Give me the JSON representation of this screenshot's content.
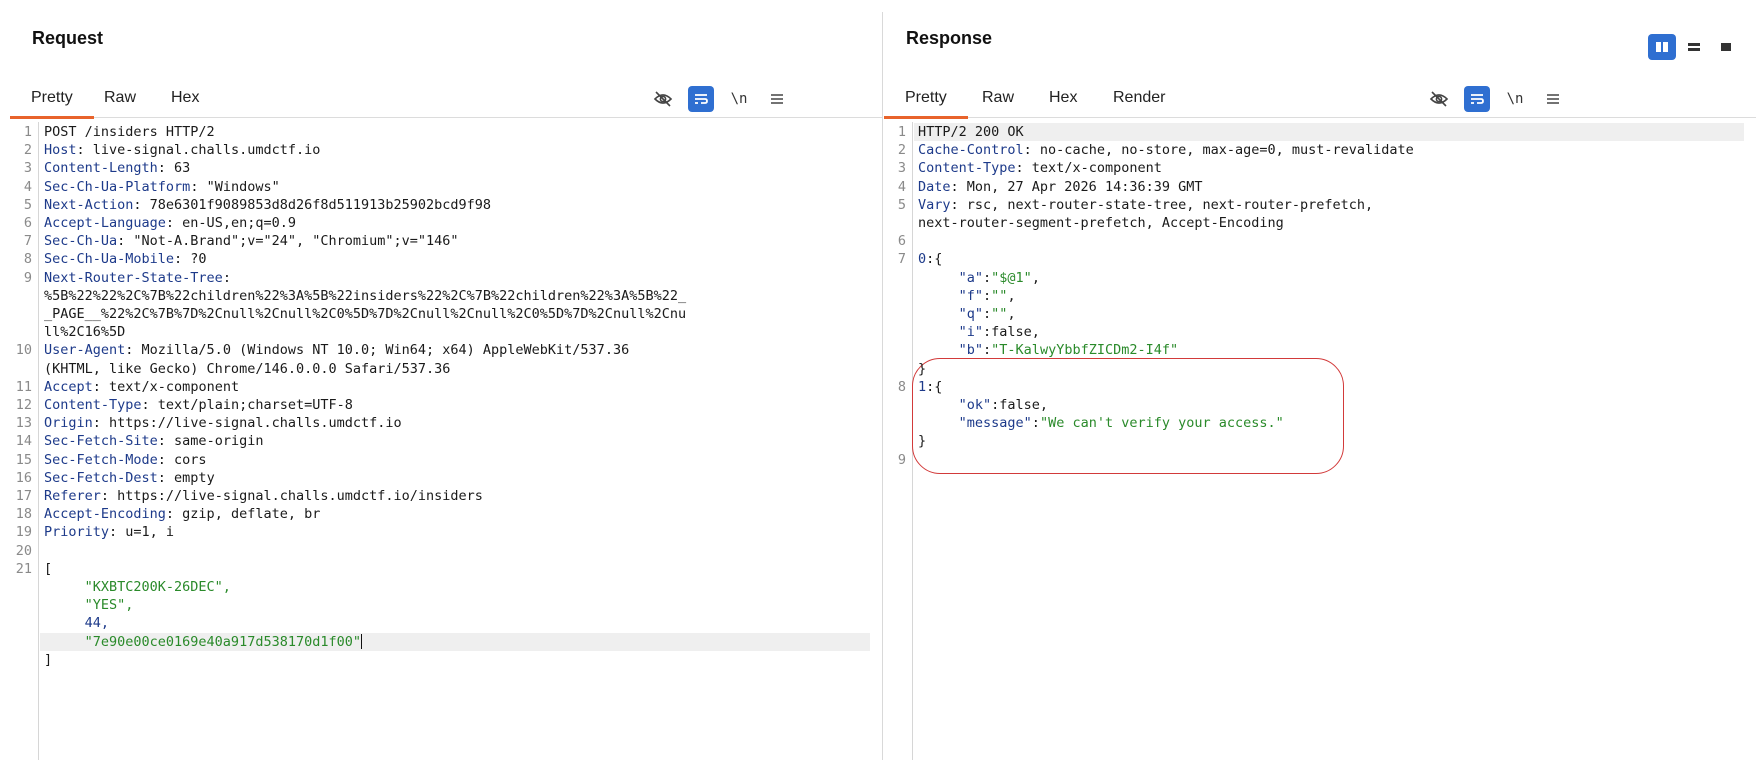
{
  "layout_switch": {
    "options": [
      "split-vertical-icon",
      "split-horizontal-icon",
      "single-pane-icon"
    ],
    "active": 0
  },
  "request": {
    "title": "Request",
    "tabs": [
      "Pretty",
      "Raw",
      "Hex"
    ],
    "active_tab": "Pretty",
    "toolbar": {
      "newline_label": "\\n"
    },
    "lines": [
      {
        "n": "1",
        "parts": [
          {
            "t": "POST /insiders HTTP/2",
            "c": "val"
          }
        ]
      },
      {
        "n": "2",
        "parts": [
          {
            "t": "Host",
            "c": "hdr"
          },
          {
            "t": ": live-signal.challs.umdctf.io",
            "c": "val"
          }
        ]
      },
      {
        "n": "3",
        "parts": [
          {
            "t": "Content-Length",
            "c": "hdr"
          },
          {
            "t": ": 63",
            "c": "val"
          }
        ]
      },
      {
        "n": "4",
        "parts": [
          {
            "t": "Sec-Ch-Ua-Platform",
            "c": "hdr"
          },
          {
            "t": ": \"Windows\"",
            "c": "val"
          }
        ]
      },
      {
        "n": "5",
        "parts": [
          {
            "t": "Next-Action",
            "c": "hdr"
          },
          {
            "t": ": 78e6301f9089853d8d26f8d511913b25902bcd9f98",
            "c": "val"
          }
        ]
      },
      {
        "n": "6",
        "parts": [
          {
            "t": "Accept-Language",
            "c": "hdr"
          },
          {
            "t": ": en-US,en;q=0.9",
            "c": "val"
          }
        ]
      },
      {
        "n": "7",
        "parts": [
          {
            "t": "Sec-Ch-Ua",
            "c": "hdr"
          },
          {
            "t": ": \"Not-A.Brand\";v=\"24\", \"Chromium\";v=\"146\"",
            "c": "val"
          }
        ]
      },
      {
        "n": "8",
        "parts": [
          {
            "t": "Sec-Ch-Ua-Mobile",
            "c": "hdr"
          },
          {
            "t": ": ?0",
            "c": "val"
          }
        ]
      },
      {
        "n": "9",
        "parts": [
          {
            "t": "Next-Router-State-Tree",
            "c": "hdr"
          },
          {
            "t": ":",
            "c": "val"
          }
        ]
      },
      {
        "n": "",
        "parts": [
          {
            "t": "%5B%22%22%2C%7B%22children%22%3A%5B%22insiders%22%2C%7B%22children%22%3A%5B%22_",
            "c": "val"
          }
        ]
      },
      {
        "n": "",
        "parts": [
          {
            "t": "_PAGE__%22%2C%7B%7D%2Cnull%2Cnull%2C0%5D%7D%2Cnull%2Cnull%2C0%5D%7D%2Cnull%2Cnu",
            "c": "val"
          }
        ]
      },
      {
        "n": "",
        "parts": [
          {
            "t": "ll%2C16%5D",
            "c": "val"
          }
        ]
      },
      {
        "n": "10",
        "parts": [
          {
            "t": "User-Agent",
            "c": "hdr"
          },
          {
            "t": ": Mozilla/5.0 (Windows NT 10.0; Win64; x64) AppleWebKit/537.36",
            "c": "val"
          }
        ]
      },
      {
        "n": "",
        "parts": [
          {
            "t": "(KHTML, like Gecko) Chrome/146.0.0.0 Safari/537.36",
            "c": "val"
          }
        ]
      },
      {
        "n": "11",
        "parts": [
          {
            "t": "Accept",
            "c": "hdr"
          },
          {
            "t": ": text/x-component",
            "c": "val"
          }
        ]
      },
      {
        "n": "12",
        "parts": [
          {
            "t": "Content-Type",
            "c": "hdr"
          },
          {
            "t": ": text/plain;charset=UTF-8",
            "c": "val"
          }
        ]
      },
      {
        "n": "13",
        "parts": [
          {
            "t": "Origin",
            "c": "hdr"
          },
          {
            "t": ": https://live-signal.challs.umdctf.io",
            "c": "val"
          }
        ]
      },
      {
        "n": "14",
        "parts": [
          {
            "t": "Sec-Fetch-Site",
            "c": "hdr"
          },
          {
            "t": ": same-origin",
            "c": "val"
          }
        ]
      },
      {
        "n": "15",
        "parts": [
          {
            "t": "Sec-Fetch-Mode",
            "c": "hdr"
          },
          {
            "t": ": cors",
            "c": "val"
          }
        ]
      },
      {
        "n": "16",
        "parts": [
          {
            "t": "Sec-Fetch-Dest",
            "c": "hdr"
          },
          {
            "t": ": empty",
            "c": "val"
          }
        ]
      },
      {
        "n": "17",
        "parts": [
          {
            "t": "Referer",
            "c": "hdr"
          },
          {
            "t": ": https://live-signal.challs.umdctf.io/insiders",
            "c": "val"
          }
        ]
      },
      {
        "n": "18",
        "parts": [
          {
            "t": "Accept-Encoding",
            "c": "hdr"
          },
          {
            "t": ": gzip, deflate, br",
            "c": "val"
          }
        ]
      },
      {
        "n": "19",
        "parts": [
          {
            "t": "Priority",
            "c": "hdr"
          },
          {
            "t": ": u=1, i",
            "c": "val"
          }
        ]
      },
      {
        "n": "20",
        "parts": []
      },
      {
        "n": "21",
        "parts": [
          {
            "t": "[",
            "c": "val"
          }
        ]
      },
      {
        "n": "",
        "parts": [
          {
            "t": "     \"KXBTC200K-26DEC\",",
            "c": "str"
          }
        ]
      },
      {
        "n": "",
        "parts": [
          {
            "t": "     \"YES\",",
            "c": "str"
          }
        ]
      },
      {
        "n": "",
        "parts": [
          {
            "t": "     44,",
            "c": "num"
          }
        ]
      },
      {
        "n": "",
        "parts": [
          {
            "t": "     \"7e90e00ce0169e40a917d538170d1f00\"",
            "c": "str"
          }
        ],
        "highlight": true,
        "cursor": true
      },
      {
        "n": "",
        "parts": [
          {
            "t": "]",
            "c": "val"
          }
        ]
      }
    ]
  },
  "response": {
    "title": "Response",
    "tabs": [
      "Pretty",
      "Raw",
      "Hex",
      "Render"
    ],
    "active_tab": "Pretty",
    "toolbar": {
      "newline_label": "\\n"
    },
    "lines": [
      {
        "n": "1",
        "parts": [
          {
            "t": "HTTP/2 200 OK",
            "c": "val"
          }
        ],
        "highlight": true
      },
      {
        "n": "2",
        "parts": [
          {
            "t": "Cache-Control",
            "c": "hdr"
          },
          {
            "t": ": no-cache, no-store, max-age=0, must-revalidate",
            "c": "val"
          }
        ]
      },
      {
        "n": "3",
        "parts": [
          {
            "t": "Content-Type",
            "c": "hdr"
          },
          {
            "t": ": text/x-component",
            "c": "val"
          }
        ]
      },
      {
        "n": "4",
        "parts": [
          {
            "t": "Date",
            "c": "hdr"
          },
          {
            "t": ": Mon, 27 Apr 2026 14:36:39 GMT",
            "c": "val"
          }
        ]
      },
      {
        "n": "5",
        "parts": [
          {
            "t": "Vary",
            "c": "hdr"
          },
          {
            "t": ": rsc, next-router-state-tree, next-router-prefetch,",
            "c": "val"
          }
        ]
      },
      {
        "n": "",
        "parts": [
          {
            "t": "next-router-segment-prefetch, Accept-Encoding",
            "c": "val"
          }
        ]
      },
      {
        "n": "6",
        "parts": []
      },
      {
        "n": "7",
        "parts": [
          {
            "t": "0",
            "c": "key"
          },
          {
            "t": ":{",
            "c": "val"
          }
        ]
      },
      {
        "n": "",
        "parts": [
          {
            "t": "     \"a\"",
            "c": "key"
          },
          {
            "t": ":",
            "c": "val"
          },
          {
            "t": "\"$@1\"",
            "c": "str"
          },
          {
            "t": ",",
            "c": "val"
          }
        ]
      },
      {
        "n": "",
        "parts": [
          {
            "t": "     \"f\"",
            "c": "key"
          },
          {
            "t": ":",
            "c": "val"
          },
          {
            "t": "\"\"",
            "c": "str"
          },
          {
            "t": ",",
            "c": "val"
          }
        ]
      },
      {
        "n": "",
        "parts": [
          {
            "t": "     \"q\"",
            "c": "key"
          },
          {
            "t": ":",
            "c": "val"
          },
          {
            "t": "\"\"",
            "c": "str"
          },
          {
            "t": ",",
            "c": "val"
          }
        ]
      },
      {
        "n": "",
        "parts": [
          {
            "t": "     \"i\"",
            "c": "key"
          },
          {
            "t": ":false,",
            "c": "val"
          }
        ]
      },
      {
        "n": "",
        "parts": [
          {
            "t": "     \"b\"",
            "c": "key"
          },
          {
            "t": ":",
            "c": "val"
          },
          {
            "t": "\"T-KalwyYbbfZICDm2-I4f\"",
            "c": "str"
          }
        ]
      },
      {
        "n": "",
        "parts": [
          {
            "t": "}",
            "c": "val"
          }
        ]
      },
      {
        "n": "8",
        "parts": [
          {
            "t": "1",
            "c": "key"
          },
          {
            "t": ":{",
            "c": "val"
          }
        ]
      },
      {
        "n": "",
        "parts": [
          {
            "t": "     \"ok\"",
            "c": "key"
          },
          {
            "t": ":false,",
            "c": "val"
          }
        ]
      },
      {
        "n": "",
        "parts": [
          {
            "t": "     \"message\"",
            "c": "key"
          },
          {
            "t": ":",
            "c": "val"
          },
          {
            "t": "\"We can't verify your access.\"",
            "c": "str"
          }
        ]
      },
      {
        "n": "",
        "parts": [
          {
            "t": "}",
            "c": "val"
          }
        ]
      },
      {
        "n": "9",
        "parts": []
      }
    ]
  },
  "colors": {
    "accent_tab_underline": "#e8632b",
    "toolbar_blue": "#2f6fd1",
    "annotation_red": "#d23a3a"
  }
}
